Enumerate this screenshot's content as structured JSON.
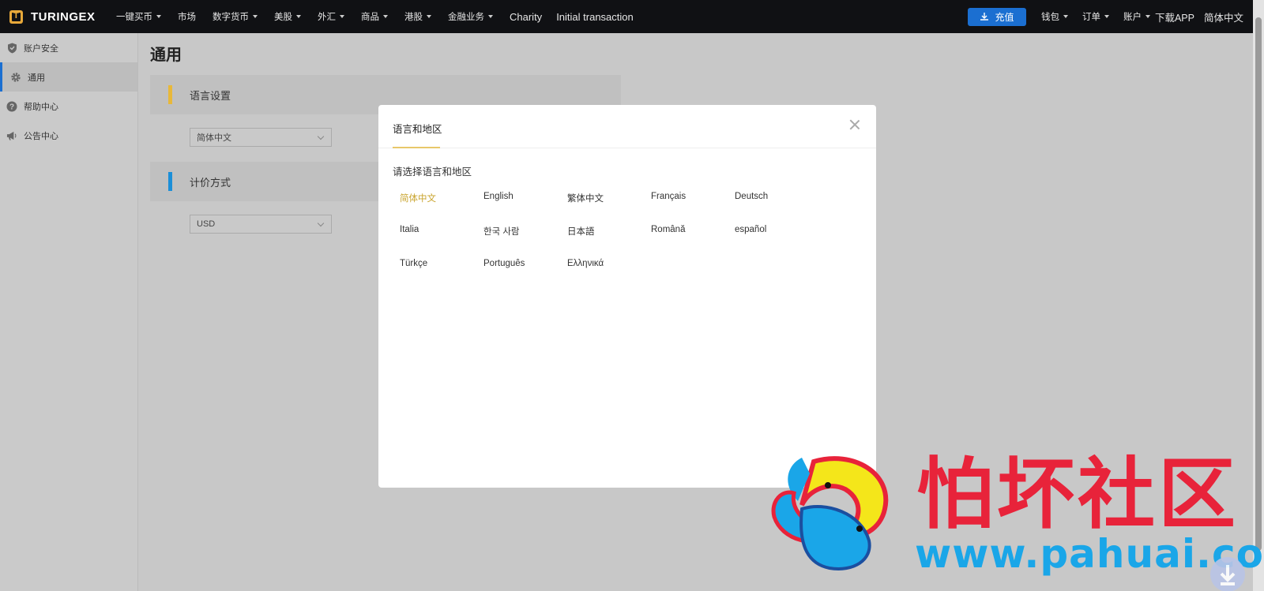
{
  "header": {
    "brand": "TURINGEX",
    "brand_mark": "T",
    "nav": [
      {
        "label": "一键买币",
        "dropdown": true
      },
      {
        "label": "市场",
        "dropdown": false
      },
      {
        "label": "数字货币",
        "dropdown": true
      },
      {
        "label": "美股",
        "dropdown": true
      },
      {
        "label": "外汇",
        "dropdown": true
      },
      {
        "label": "商品",
        "dropdown": true
      },
      {
        "label": "港股",
        "dropdown": true
      },
      {
        "label": "金融业务",
        "dropdown": true
      },
      {
        "label": "Charity",
        "dropdown": false
      },
      {
        "label": "Initial transaction",
        "dropdown": false
      }
    ],
    "deposit_label": "充值",
    "right_nav": [
      {
        "label": "钱包",
        "dropdown": true
      },
      {
        "label": "订单",
        "dropdown": true
      },
      {
        "label": "账户",
        "dropdown": true
      },
      {
        "label": "下载APP",
        "dropdown": false
      },
      {
        "label": "简体中文",
        "dropdown": false
      }
    ],
    "accent_color": "#1b6fd1"
  },
  "sidebar": {
    "items": [
      {
        "label": "账户安全",
        "icon": "shield-icon",
        "active": false
      },
      {
        "label": "通用",
        "icon": "gear-icon",
        "active": true
      },
      {
        "label": "帮助中心",
        "icon": "help-icon",
        "active": false
      },
      {
        "label": "公告中心",
        "icon": "megaphone-icon",
        "active": false
      }
    ]
  },
  "main": {
    "title": "通用",
    "sections": [
      {
        "title": "语言设置",
        "bar_color": "#e8b83a",
        "select_value": "简体中文"
      },
      {
        "title": "计价方式",
        "bar_color": "#1b8fd8",
        "select_value": "USD"
      }
    ]
  },
  "modal": {
    "tab": "语言和地区",
    "subtitle": "请选择语言和地区",
    "selected_color": "#c9a42e",
    "languages": [
      {
        "label": "简体中文",
        "selected": true
      },
      {
        "label": "English",
        "selected": false
      },
      {
        "label": "繁体中文",
        "selected": false
      },
      {
        "label": "Français",
        "selected": false
      },
      {
        "label": "Deutsch",
        "selected": false
      },
      {
        "label": "Italia",
        "selected": false
      },
      {
        "label": "한국 사람",
        "selected": false
      },
      {
        "label": "日本語",
        "selected": false
      },
      {
        "label": "Română",
        "selected": false
      },
      {
        "label": "español",
        "selected": false
      },
      {
        "label": "Türkçe",
        "selected": false
      },
      {
        "label": "Português",
        "selected": false
      },
      {
        "label": "Ελληνικά",
        "selected": false
      }
    ]
  },
  "watermark": {
    "text": "怕坏社区",
    "url": "www.pahuai.com"
  }
}
